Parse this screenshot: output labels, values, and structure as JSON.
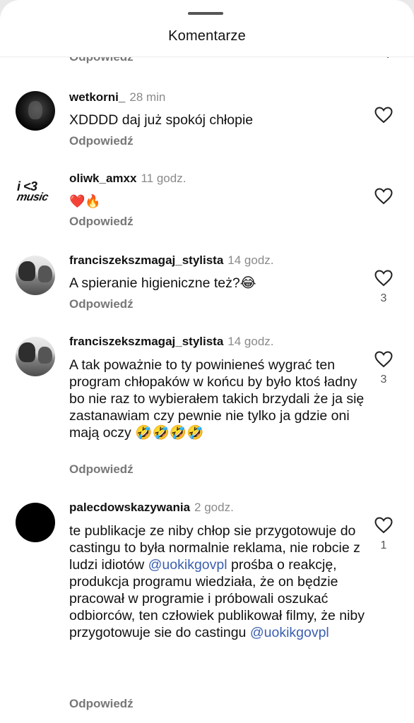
{
  "header": {
    "title": "Komentarze"
  },
  "partial_above": {
    "reply_label": "Odpowiedź"
  },
  "comments": [
    {
      "username": "wetkorni_",
      "time": "28 min",
      "text": "XDDDD daj już spokój chłopie",
      "reply_label": "Odpowiedź",
      "likes": ""
    },
    {
      "username": "oliwk_amxx",
      "time": "11 godz.",
      "text": "❤️🔥",
      "reply_label": "Odpowiedź",
      "likes": "",
      "avatar_text_line1": "i <3",
      "avatar_text_line2": "music"
    },
    {
      "username": "franciszekszmagaj_stylista",
      "time": "14 godz.",
      "text": "A spieranie higieniczne też?😂",
      "reply_label": "Odpowiedź",
      "likes": "3"
    },
    {
      "username": "franciszekszmagaj_stylista",
      "time": "14 godz.",
      "text": "A tak poważnie to ty powinieneś wygrać ten program chłopaków w końcu by było ktoś ładny bo nie raz to wybierałem takich brzydali że ja się zastanawiam czy pewnie nie tylko ja gdzie oni mają oczy 🤣🤣🤣🤣",
      "reply_label": "Odpowiedź",
      "likes": "3"
    },
    {
      "username": "palecdowskazywania",
      "time": "2 godz.",
      "text_part1": "te publikacje ze niby chłop sie przygotowuje do castingu to była normalnie reklama, nie robcie z ludzi idiotów ",
      "mention1": "@uokikgovpl",
      "text_part2": " prośba o reakcję, produkcja programu wiedziała, że on będzie pracował w programie i próbowali oszukać odbiorców, ten człowiek publikował filmy, że niby przygotowuje sie do castingu ",
      "mention2": "@uokikgovpl",
      "reply_label": "Odpowiedź",
      "likes": "1"
    }
  ],
  "colors": {
    "mention": "#3b5fb0",
    "muted": "#777777",
    "time": "#8a8a8a"
  },
  "icons": {
    "like": "heart-outline-icon"
  }
}
